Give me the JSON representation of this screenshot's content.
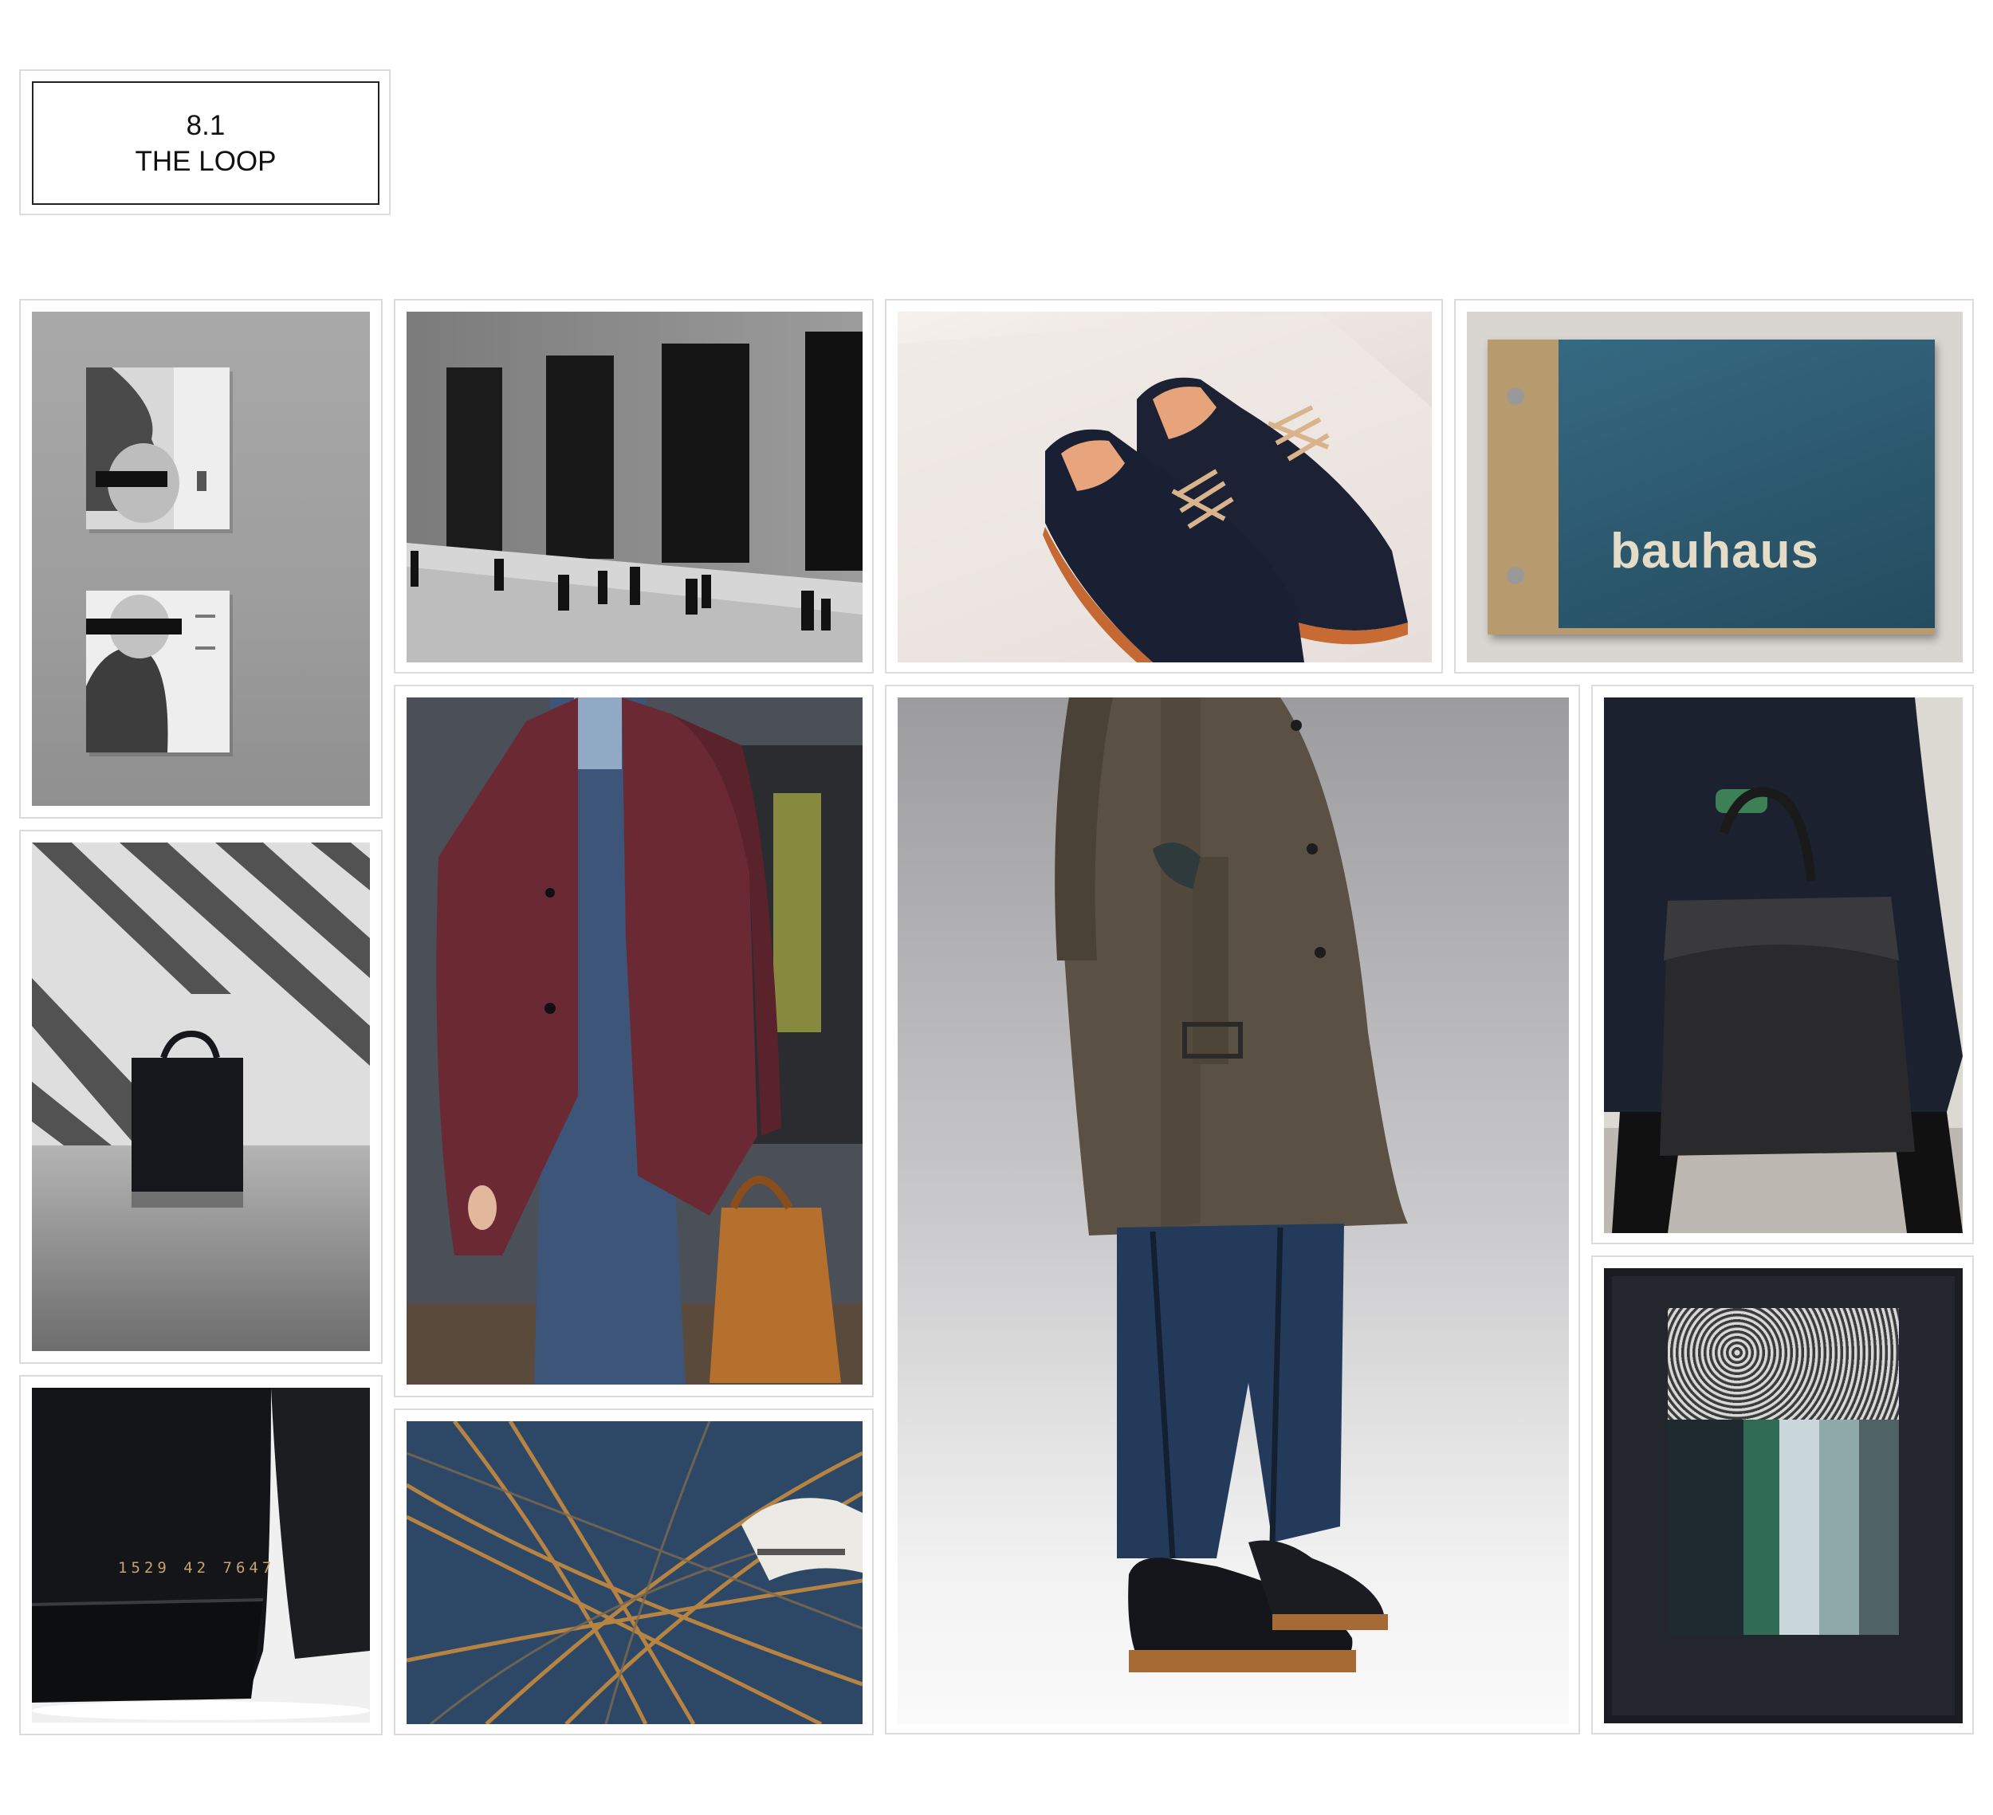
{
  "header": {
    "number": "8.1",
    "title": "THE LOOP"
  },
  "tiles": [
    {
      "subject": "two-books-cover-photo"
    },
    {
      "subject": "street-pedestrians-photo"
    },
    {
      "subject": "brogue-shoes-photo"
    },
    {
      "subject": "bauhaus-book-photo",
      "text": "bauhaus"
    },
    {
      "subject": "black-bag-shadows-photo"
    },
    {
      "subject": "burgundy-coat-runway-photo"
    },
    {
      "subject": "trench-coat-model-photo"
    },
    {
      "subject": "leather-tote-runway-photo"
    },
    {
      "subject": "sneaker-heel-closeup-photo",
      "text": "1529 42 7647"
    },
    {
      "subject": "railway-tracks-aerial-photo"
    },
    {
      "subject": "framed-artwork-photo"
    }
  ],
  "colors": {
    "frame_border": "#dcdcdc",
    "title_border": "#222222",
    "bauhaus_cover": "#2f5c73",
    "burgundy_coat": "#6b2a33",
    "tan_bag": "#b5702e",
    "trench_coat": "#5a5043",
    "trouser_blue": "#243a5a"
  }
}
